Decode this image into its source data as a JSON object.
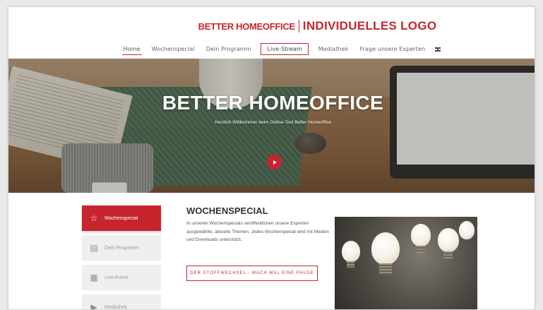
{
  "brand": {
    "logo_main": "BETTER HOMEOFFICE",
    "logo_sub": "INDIVIDUELLES LOGO",
    "accent_color": "#c6252e"
  },
  "nav": {
    "items": [
      {
        "label": "Home",
        "active": true
      },
      {
        "label": "Wochenspecial"
      },
      {
        "label": "Dein Programm"
      },
      {
        "label": "Live-Stream",
        "boxed": true
      },
      {
        "label": "Mediathek"
      },
      {
        "label": "Frage unsere Experten"
      }
    ],
    "language_icon": "uk-flag-icon"
  },
  "hero": {
    "title": "BETTER HOMEOFFICE",
    "subtitle": "Herzlich Willkommen beim Online-Tool Better Homeoffice",
    "play_icon": "play-icon"
  },
  "sidebar": {
    "items": [
      {
        "label": "Wochenspecial",
        "icon": "star-icon",
        "active": true
      },
      {
        "label": "Dein Programm",
        "icon": "list-icon"
      },
      {
        "label": "Live-Kurse",
        "icon": "calendar-icon"
      },
      {
        "label": "Mediathek",
        "icon": "play-icon"
      }
    ]
  },
  "content": {
    "title": "WOCHENSPECIAL",
    "text": "In unseren Wochenspecials veröffentlichen unsere Experten ausgewählte, aktuelle Themen. Jedes Wochenspecial wird mit Medien und Downloads unterstützt.",
    "cta_label": "DER STOFFWECHSEL - MACH MAL EINE PAUSE"
  }
}
